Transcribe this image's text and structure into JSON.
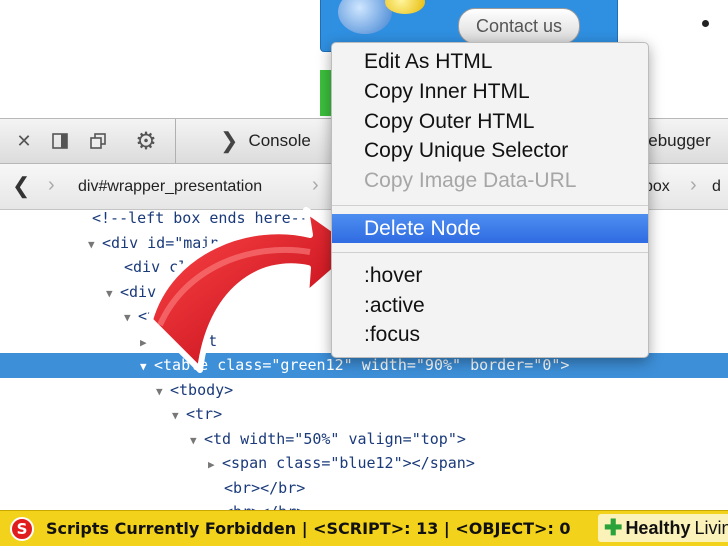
{
  "webpage": {
    "contact_button": "Contact us"
  },
  "toolbar": {
    "console_label": "Console",
    "debugger_label": "Debugger"
  },
  "breadcrumbs": {
    "items": [
      "div#wrapper_presentation",
      "box",
      "d"
    ]
  },
  "markup": {
    "lines": [
      {
        "indent": 92,
        "text": "<!--left box ends here-->"
      },
      {
        "indent": 88,
        "twisty": "▼",
        "text": "<div id=\"main_"
      },
      {
        "indent": 124,
        "text": "<div class=\"co"
      },
      {
        "indent": 106,
        "twisty": "▼",
        "text": "<div class=\""
      },
      {
        "indent": 124,
        "twisty": "▼",
        "text": "<table"
      },
      {
        "indent": 140,
        "twisty": "▶",
        "text": "  fight"
      },
      {
        "indent": 140,
        "twisty": "▼",
        "text": "<table class=\"green12\" width=\"90%\" border=\"0\">",
        "selected": true
      },
      {
        "indent": 156,
        "twisty": "▼",
        "text": "<tbody>"
      },
      {
        "indent": 172,
        "twisty": "▼",
        "text": "<tr>"
      },
      {
        "indent": 190,
        "twisty": "▼",
        "text": "<td width=\"50%\" valign=\"top\">"
      },
      {
        "indent": 208,
        "twisty": "▶",
        "text": "<span class=\"blue12\"></span>"
      },
      {
        "indent": 224,
        "text": "<br></br>"
      },
      {
        "indent": 224,
        "text": "<br></br>"
      }
    ]
  },
  "context_menu": {
    "group1": [
      "Edit As HTML",
      "Copy Inner HTML",
      "Copy Outer HTML",
      "Copy Unique Selector"
    ],
    "disabled_item": "Copy Image Data-URL",
    "highlighted_item": "Delete Node",
    "group3": [
      ":hover",
      ":active",
      ":focus"
    ]
  },
  "statusbar": {
    "icon_letter": "S",
    "text": "Scripts Currently Forbidden | <SCRIPT>: 13 | <OBJECT>: 0"
  },
  "watermark": {
    "part1": "Healthy",
    "part2": "Living"
  },
  "colors": {
    "selection": "#3d8fd8",
    "menu_highlight": "#2f6be2",
    "statusbar": "#f2d21a",
    "arrow": "#e0141e"
  },
  "icons": [
    "close-icon",
    "dock-icon",
    "popout-icon",
    "gear-icon",
    "console-chevron-icon",
    "debugger-icon",
    "back-chevron-icon",
    "noscript-icon",
    "red-arrow-icon"
  ]
}
